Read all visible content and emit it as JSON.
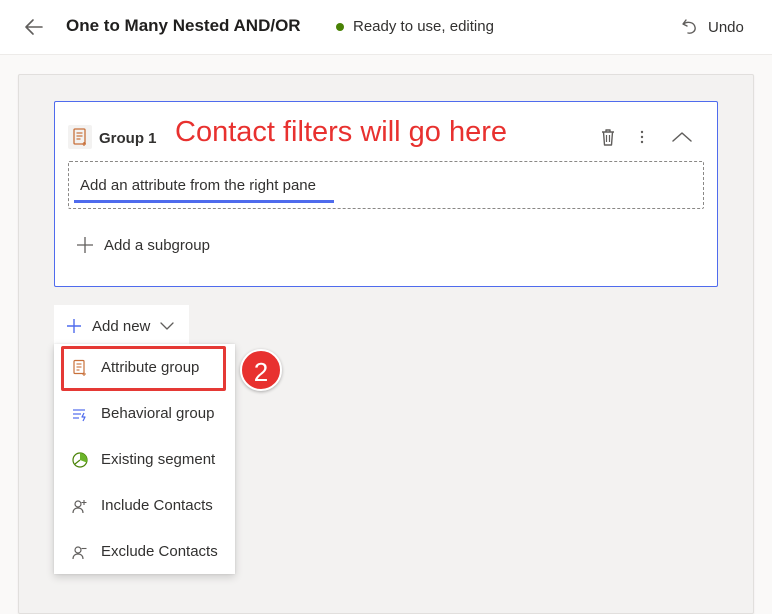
{
  "header": {
    "title": "One to Many Nested AND/OR",
    "status": "Ready to use, editing",
    "status_color": "#498205",
    "undo_label": "Undo",
    "back_icon": "back-arrow-icon",
    "undo_icon": "undo-icon"
  },
  "group": {
    "name": "Group 1",
    "icon": "attribute-group-icon",
    "attribute_placeholder": "Add an attribute from the right pane",
    "add_subgroup_label": "Add a subgroup",
    "actions": [
      "delete-icon",
      "more-icon",
      "collapse-icon"
    ]
  },
  "annotations": {
    "callout": "Contact filters will go here",
    "step_number": "2",
    "color": "#e8312f"
  },
  "add_new": {
    "label": "Add new",
    "menu": [
      {
        "label": "Attribute group",
        "icon": "attribute-group-icon",
        "highlighted": true
      },
      {
        "label": "Behavioral group",
        "icon": "behavioral-group-icon"
      },
      {
        "label": "Existing segment",
        "icon": "segment-icon"
      },
      {
        "label": "Include Contacts",
        "icon": "include-contacts-icon"
      },
      {
        "label": "Exclude Contacts",
        "icon": "exclude-contacts-icon"
      }
    ]
  },
  "colors": {
    "accent": "#4f6bed",
    "highlight": "#e53935"
  }
}
